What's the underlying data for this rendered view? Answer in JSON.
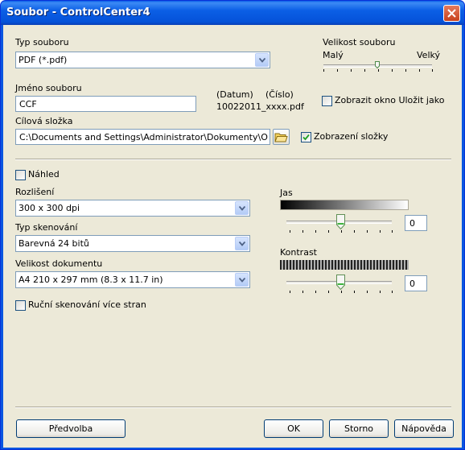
{
  "window": {
    "title": "Soubor - ControlCenter4"
  },
  "file_type": {
    "label": "Typ souboru",
    "value": "PDF (*.pdf)"
  },
  "file_size": {
    "label": "Velikost souboru",
    "min_label": "Malý",
    "max_label": "Velký",
    "level": 0.5
  },
  "file_name": {
    "label": "Jméno souboru",
    "value": "CCF",
    "date_label": "(Datum)",
    "number_label": "(Číslo)",
    "example": "10022011_xxxx.pdf"
  },
  "show_save_as": {
    "label": "Zobrazit okno Uložit jako",
    "checked": false
  },
  "target_folder": {
    "label": "Cílová složka",
    "value": "C:\\Documents and Settings\\Administrator\\Dokumenty\\Obrázky\\"
  },
  "show_folder": {
    "label": "Zobrazení složky",
    "checked": true
  },
  "preview": {
    "label": "Náhled",
    "checked": false
  },
  "resolution": {
    "label": "Rozlišení",
    "value": "300 x 300 dpi"
  },
  "scan_type": {
    "label": "Typ skenování",
    "value": "Barevná 24 bitů"
  },
  "document_size": {
    "label": "Velikost dokumentu",
    "value": "A4 210 x 297 mm (8.3 x 11.7 in)"
  },
  "manual_duplex": {
    "label": "Ruční skenování více stran",
    "checked": false
  },
  "brightness": {
    "label": "Jas",
    "value": "0"
  },
  "contrast": {
    "label": "Kontrast",
    "value": "0"
  },
  "buttons": {
    "preview": "Předvolba",
    "ok": "OK",
    "cancel": "Storno",
    "help": "Nápověda"
  },
  "colors": {
    "titlebar": "#0a56e0",
    "dialog": "#ece9d8",
    "close": "#c8421d"
  }
}
